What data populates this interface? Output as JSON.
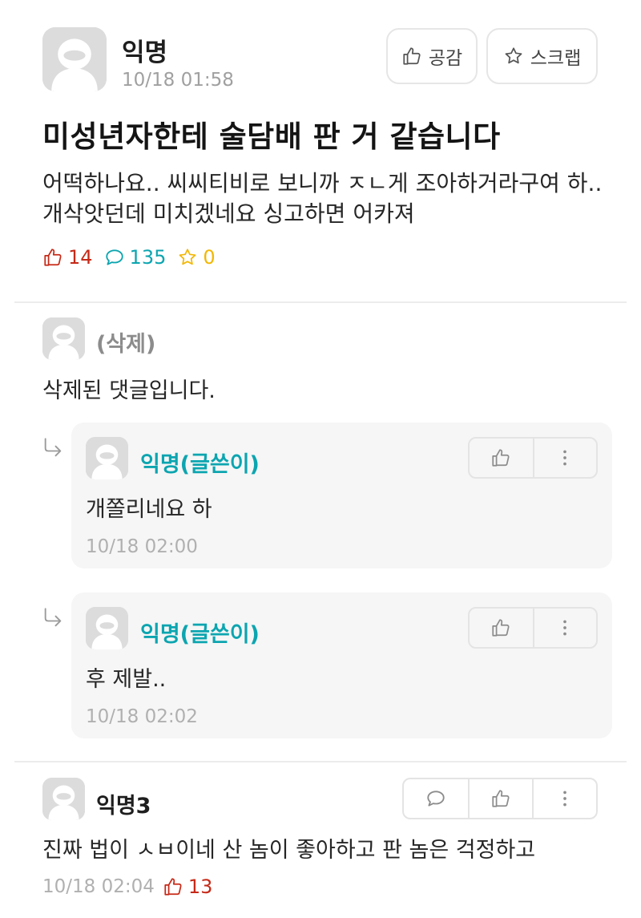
{
  "post": {
    "author": "익명",
    "time": "10/18 01:58",
    "like_button": "공감",
    "scrap_button": "스크랩",
    "title": "미성년자한테 술담배 판 거 같습니다",
    "body": "어떡하나요.. 씨씨티비로 보니까 ㅈㄴ게 조아하거라구여 하.. 개삭앗던데 미치겠네요 싱고하면 어카져",
    "likes": "14",
    "comments": "135",
    "scraps": "0"
  },
  "deleted_comment": {
    "author": "(삭제)",
    "text": "삭제된 댓글입니다."
  },
  "replies": [
    {
      "author": "익명(글쓴이)",
      "text": "개쫄리네요 하",
      "time": "10/18 02:00"
    },
    {
      "author": "익명(글쓴이)",
      "text": "후 제발..",
      "time": "10/18 02:02"
    }
  ],
  "comment3": {
    "author": "익명3",
    "text": "진짜 법이 ㅅㅂ이네 산 놈이 좋아하고 판 놈은 걱정하고",
    "time": "10/18 02:04",
    "likes": "13"
  },
  "colors": {
    "like_red": "#c62917",
    "comment_teal": "#0ca5b0",
    "scrap_yellow": "#f2b705",
    "author_teal": "#0ca5b0"
  },
  "icons": {
    "thumbs_up": "thumbs-up-icon",
    "star": "star-icon",
    "speech_bubble": "speech-bubble-icon",
    "more": "more-vertical-icon",
    "reply_arrow": "reply-arrow-icon",
    "avatar": "default-avatar-icon"
  }
}
